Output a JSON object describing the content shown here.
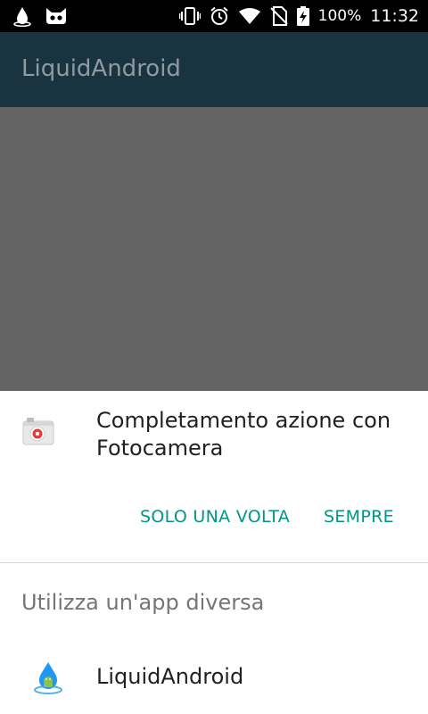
{
  "status_bar": {
    "battery_percent": "100%",
    "time": "11:32",
    "left_icons": [
      "liquid-drop-icon",
      "cat-icon"
    ],
    "right_icons": [
      "vibrate-icon",
      "alarm-icon",
      "wifi-icon",
      "no-sim-icon",
      "battery-charging-icon"
    ]
  },
  "app_bar": {
    "title": "LiquidAndroid"
  },
  "chooser": {
    "default_app": {
      "icon": "camera-app-icon",
      "title": "Completamento azione con Fotocamera"
    },
    "buttons": {
      "once": "SOLO UNA VOLTA",
      "always": "SEMPRE"
    },
    "other_heading": "Utilizza un'app diversa",
    "apps": [
      {
        "icon": "liquid-android-app-icon",
        "label": "LiquidAndroid"
      }
    ]
  },
  "colors": {
    "accent": "#009688",
    "app_bar_dimmed": "#1a3340",
    "scrim": "#636363"
  }
}
